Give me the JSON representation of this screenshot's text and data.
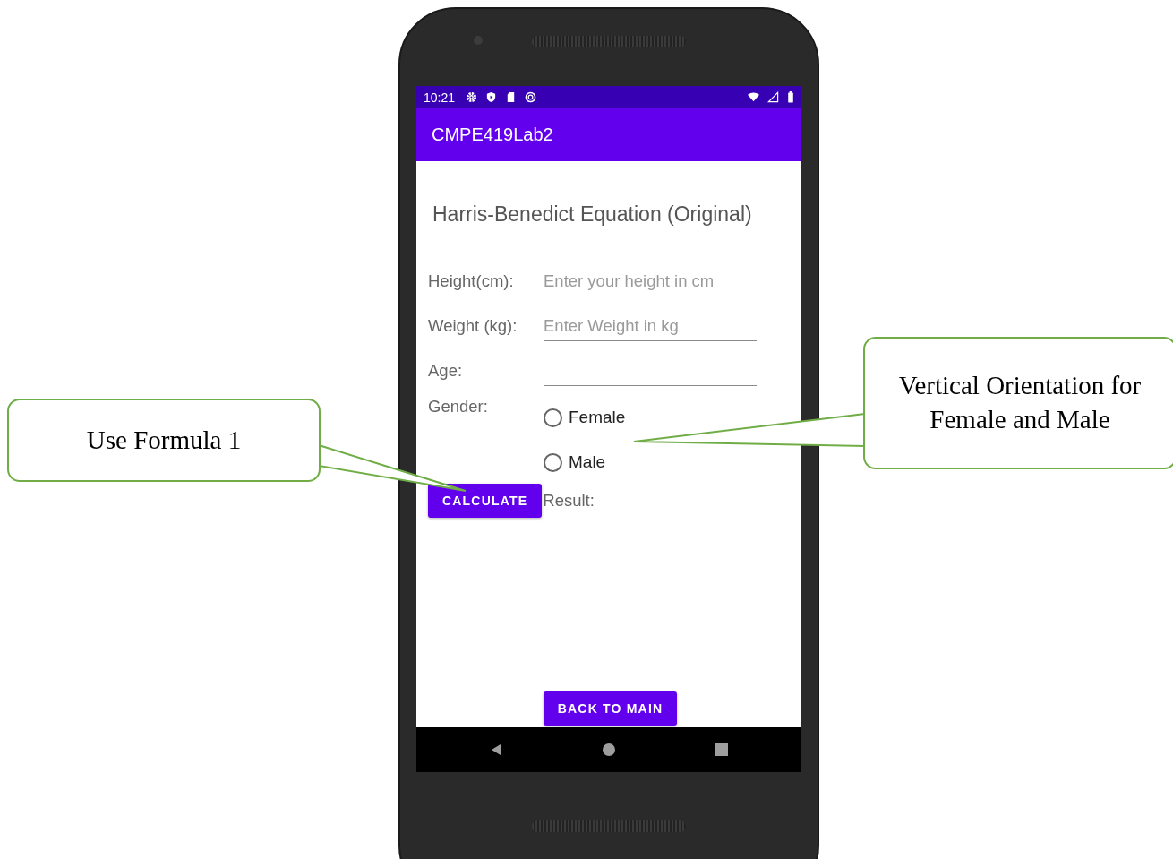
{
  "status_bar": {
    "time": "10:21"
  },
  "app_bar": {
    "title": "CMPE419Lab2"
  },
  "heading": "Harris-Benedict Equation (Original)",
  "fields": [
    {
      "label": "Height(cm):",
      "placeholder": "Enter your height in cm"
    },
    {
      "label": "Weight (kg):",
      "placeholder": "Enter Weight in kg"
    },
    {
      "label": "Age:"
    }
  ],
  "gender": {
    "label": "Gender:",
    "options": [
      {
        "label": "Female",
        "selected": false
      },
      {
        "label": "Male",
        "selected": false
      }
    ]
  },
  "calculate_button": "CALCULATE",
  "result_label": "Result:",
  "back_button": "BACK TO MAIN",
  "callouts": [
    {
      "text": "Use Formula 1"
    },
    {
      "text": "Vertical Orientation for Female and Male"
    }
  ]
}
